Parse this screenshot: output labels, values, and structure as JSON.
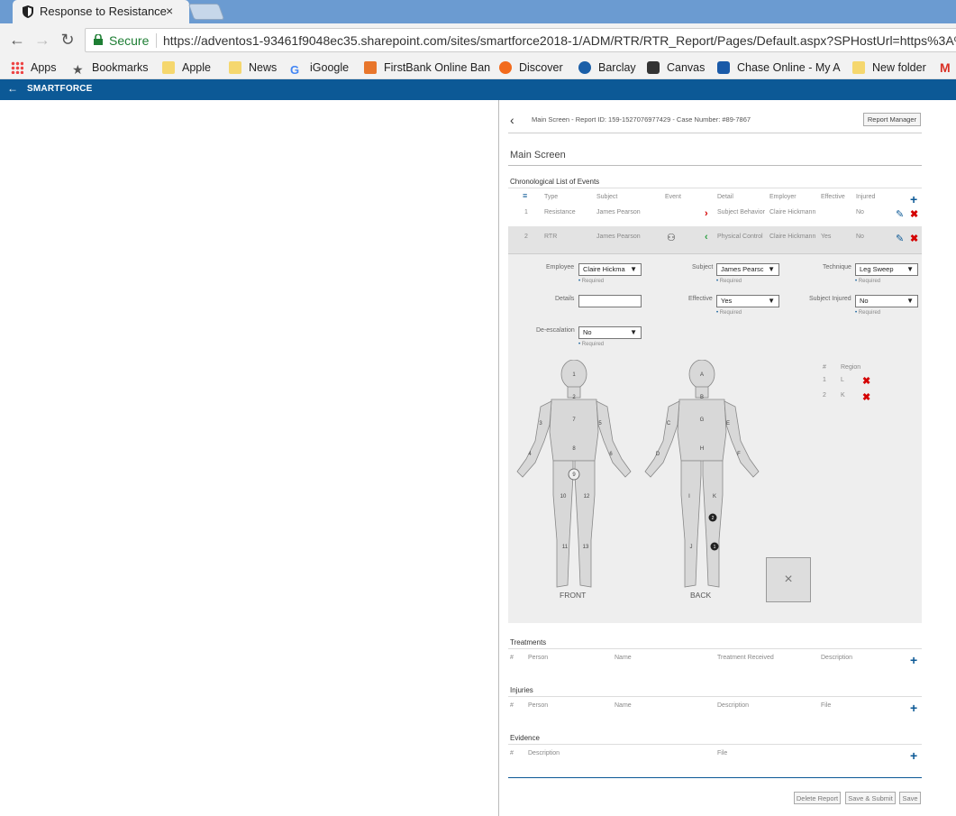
{
  "browser": {
    "tab_title": "Response to Resistance",
    "tab_close": "×",
    "secure_label": "Secure",
    "url": "https://adventos1-93461f9048ec35.sharepoint.com/sites/smartforce2018-1/ADM/RTR/RTR_Report/Pages/Default.aspx?SPHostUrl=https%3A%2",
    "bookmarks": [
      "Apps",
      "Bookmarks",
      "Apple",
      "News",
      "iGoogle",
      "FirstBank Online Ban",
      "Discover",
      "Barclay",
      "Canvas",
      "Chase Online - My A",
      "New folder"
    ]
  },
  "appbar": {
    "brand": "SMARTFORCE",
    "back": "←"
  },
  "header": {
    "breadcrumb": "Main Screen - Report ID: 159-1527076977429 - Case Number: #89-7867",
    "report_manager": "Report Manager",
    "title": "Main Screen"
  },
  "events": {
    "section_title": "Chronological List of Events",
    "columns": [
      "Type",
      "Subject",
      "Event",
      "Detail",
      "Employer",
      "Effective",
      "Injured"
    ],
    "rows": [
      {
        "num": "1",
        "type": "Resistance",
        "subject": "James Pearson",
        "detail": "Subject Behavior",
        "employer": "Claire Hickmann",
        "effective": "",
        "injured": "No"
      },
      {
        "num": "2",
        "type": "RTR",
        "subject": "James Pearson",
        "detail": "Physical Control",
        "employer": "Claire Hickmann",
        "effective": "Yes",
        "injured": "No"
      }
    ]
  },
  "form": {
    "employee_label": "Employee",
    "employee_value": "Claire Hickma",
    "subject_label": "Subject",
    "subject_value": "James Pearsc",
    "technique_label": "Technique",
    "technique_value": "Leg Sweep",
    "details_label": "Details",
    "details_value": "",
    "effective_label": "Effective",
    "effective_value": "Yes",
    "subject_injured_label": "Subject Injured",
    "subject_injured_value": "No",
    "deescalation_label": "De-escalation",
    "deescalation_value": "No",
    "required": "Required"
  },
  "body_map": {
    "front_label": "FRONT",
    "back_label": "BACK",
    "front_numbers": [
      "1",
      "2",
      "3",
      "4",
      "5",
      "6",
      "7",
      "8",
      "9",
      "10",
      "11",
      "12",
      "13"
    ],
    "back_letters": [
      "A",
      "B",
      "C",
      "D",
      "E",
      "F",
      "G",
      "H",
      "I",
      "J",
      "K"
    ],
    "back_markers": [
      "2",
      "1"
    ],
    "region_header_num": "#",
    "region_header": "Region",
    "regions": [
      {
        "num": "1",
        "region": "L"
      },
      {
        "num": "2",
        "region": "K"
      }
    ],
    "clear_box": "×"
  },
  "treatments": {
    "title": "Treatments",
    "columns": [
      "#",
      "Person",
      "Name",
      "Treatment Received",
      "Description"
    ]
  },
  "injuries": {
    "title": "Injuries",
    "columns": [
      "#",
      "Person",
      "Name",
      "Description",
      "File"
    ]
  },
  "evidence": {
    "title": "Evidence",
    "columns": [
      "#",
      "Description",
      "File"
    ]
  },
  "footer": {
    "delete": "Delete Report",
    "save_submit": "Save & Submit",
    "save": "Save"
  }
}
